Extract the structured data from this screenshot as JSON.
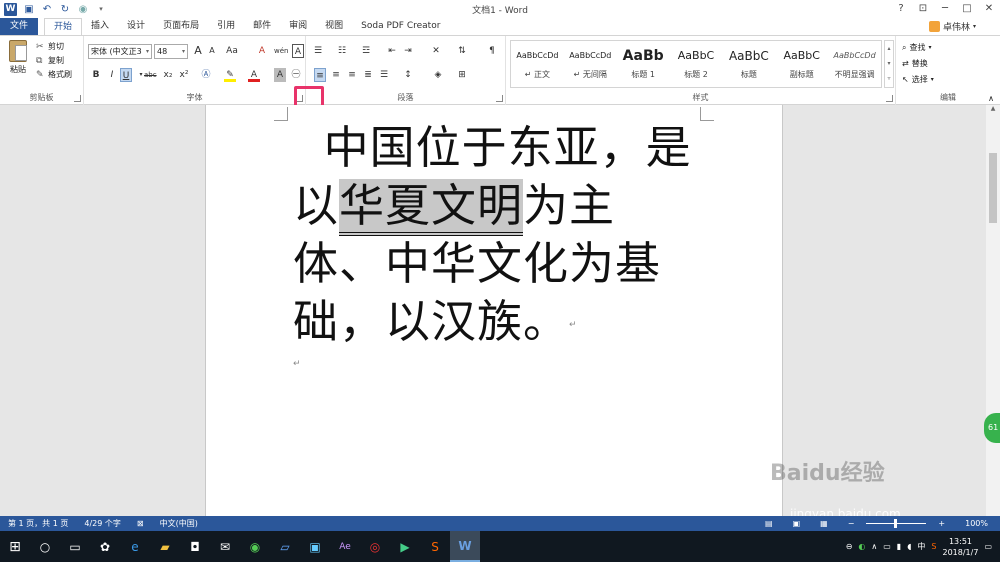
{
  "titlebar": {
    "title": "文档1 - Word",
    "help": "?",
    "minimize": "─",
    "maximize": "□",
    "close": "✕"
  },
  "tabs": [
    {
      "label": "文件"
    },
    {
      "label": "开始"
    },
    {
      "label": "插入"
    },
    {
      "label": "设计"
    },
    {
      "label": "页面布局"
    },
    {
      "label": "引用"
    },
    {
      "label": "邮件"
    },
    {
      "label": "审阅"
    },
    {
      "label": "视图"
    },
    {
      "label": "Soda PDF Creator"
    }
  ],
  "user": {
    "name": "卓伟林"
  },
  "clipboard": {
    "paste": "粘贴",
    "cut": "剪切",
    "copy": "复制",
    "format_painter": "格式刷",
    "group_label": "剪贴板"
  },
  "font": {
    "name": "宋体 (中文正3",
    "size": "48",
    "group_label": "字体",
    "bold": "B",
    "italic": "I",
    "underline": "U",
    "strike": "abc",
    "sub": "x₂",
    "sup": "x²",
    "grow": "A",
    "shrink": "A",
    "case": "Aa",
    "clear": "A",
    "wen": "wén",
    "border_char": "A"
  },
  "paragraph": {
    "group_label": "段落"
  },
  "styles": {
    "group_label": "样式",
    "items": [
      {
        "sample": "AaBbCcDd",
        "name": "↵ 正文"
      },
      {
        "sample": "AaBbCcDd",
        "name": "↵ 无间隔"
      },
      {
        "sample": "AaBb",
        "name": "标题 1"
      },
      {
        "sample": "AaBbC",
        "name": "标题 2"
      },
      {
        "sample": "AaBbC",
        "name": "标题"
      },
      {
        "sample": "AaBbC",
        "name": "副标题"
      },
      {
        "sample": "AaBbCcDd",
        "name": "不明显强调"
      }
    ]
  },
  "editing": {
    "group_label": "编辑",
    "find": "查找",
    "replace": "替换",
    "select": "选择"
  },
  "document": {
    "line1": "中国位于东亚，是",
    "line2_a": "以",
    "line2_sel": "华夏文明",
    "line2_b": "为主",
    "line3": "体、中华文化为基",
    "line4": "础，以汉族。",
    "pilcrow": "↵"
  },
  "side_badge": "61",
  "watermark": {
    "text": "Baidu经验",
    "url": "jingyan.baidu.com"
  },
  "status": {
    "page": "第 1 页，共 1 页",
    "words": "4/29 个字",
    "lang": "中文(中国)",
    "zoom": "100%"
  },
  "tray": {
    "ime": "中",
    "time": "13:51",
    "date": "2018/1/7"
  }
}
